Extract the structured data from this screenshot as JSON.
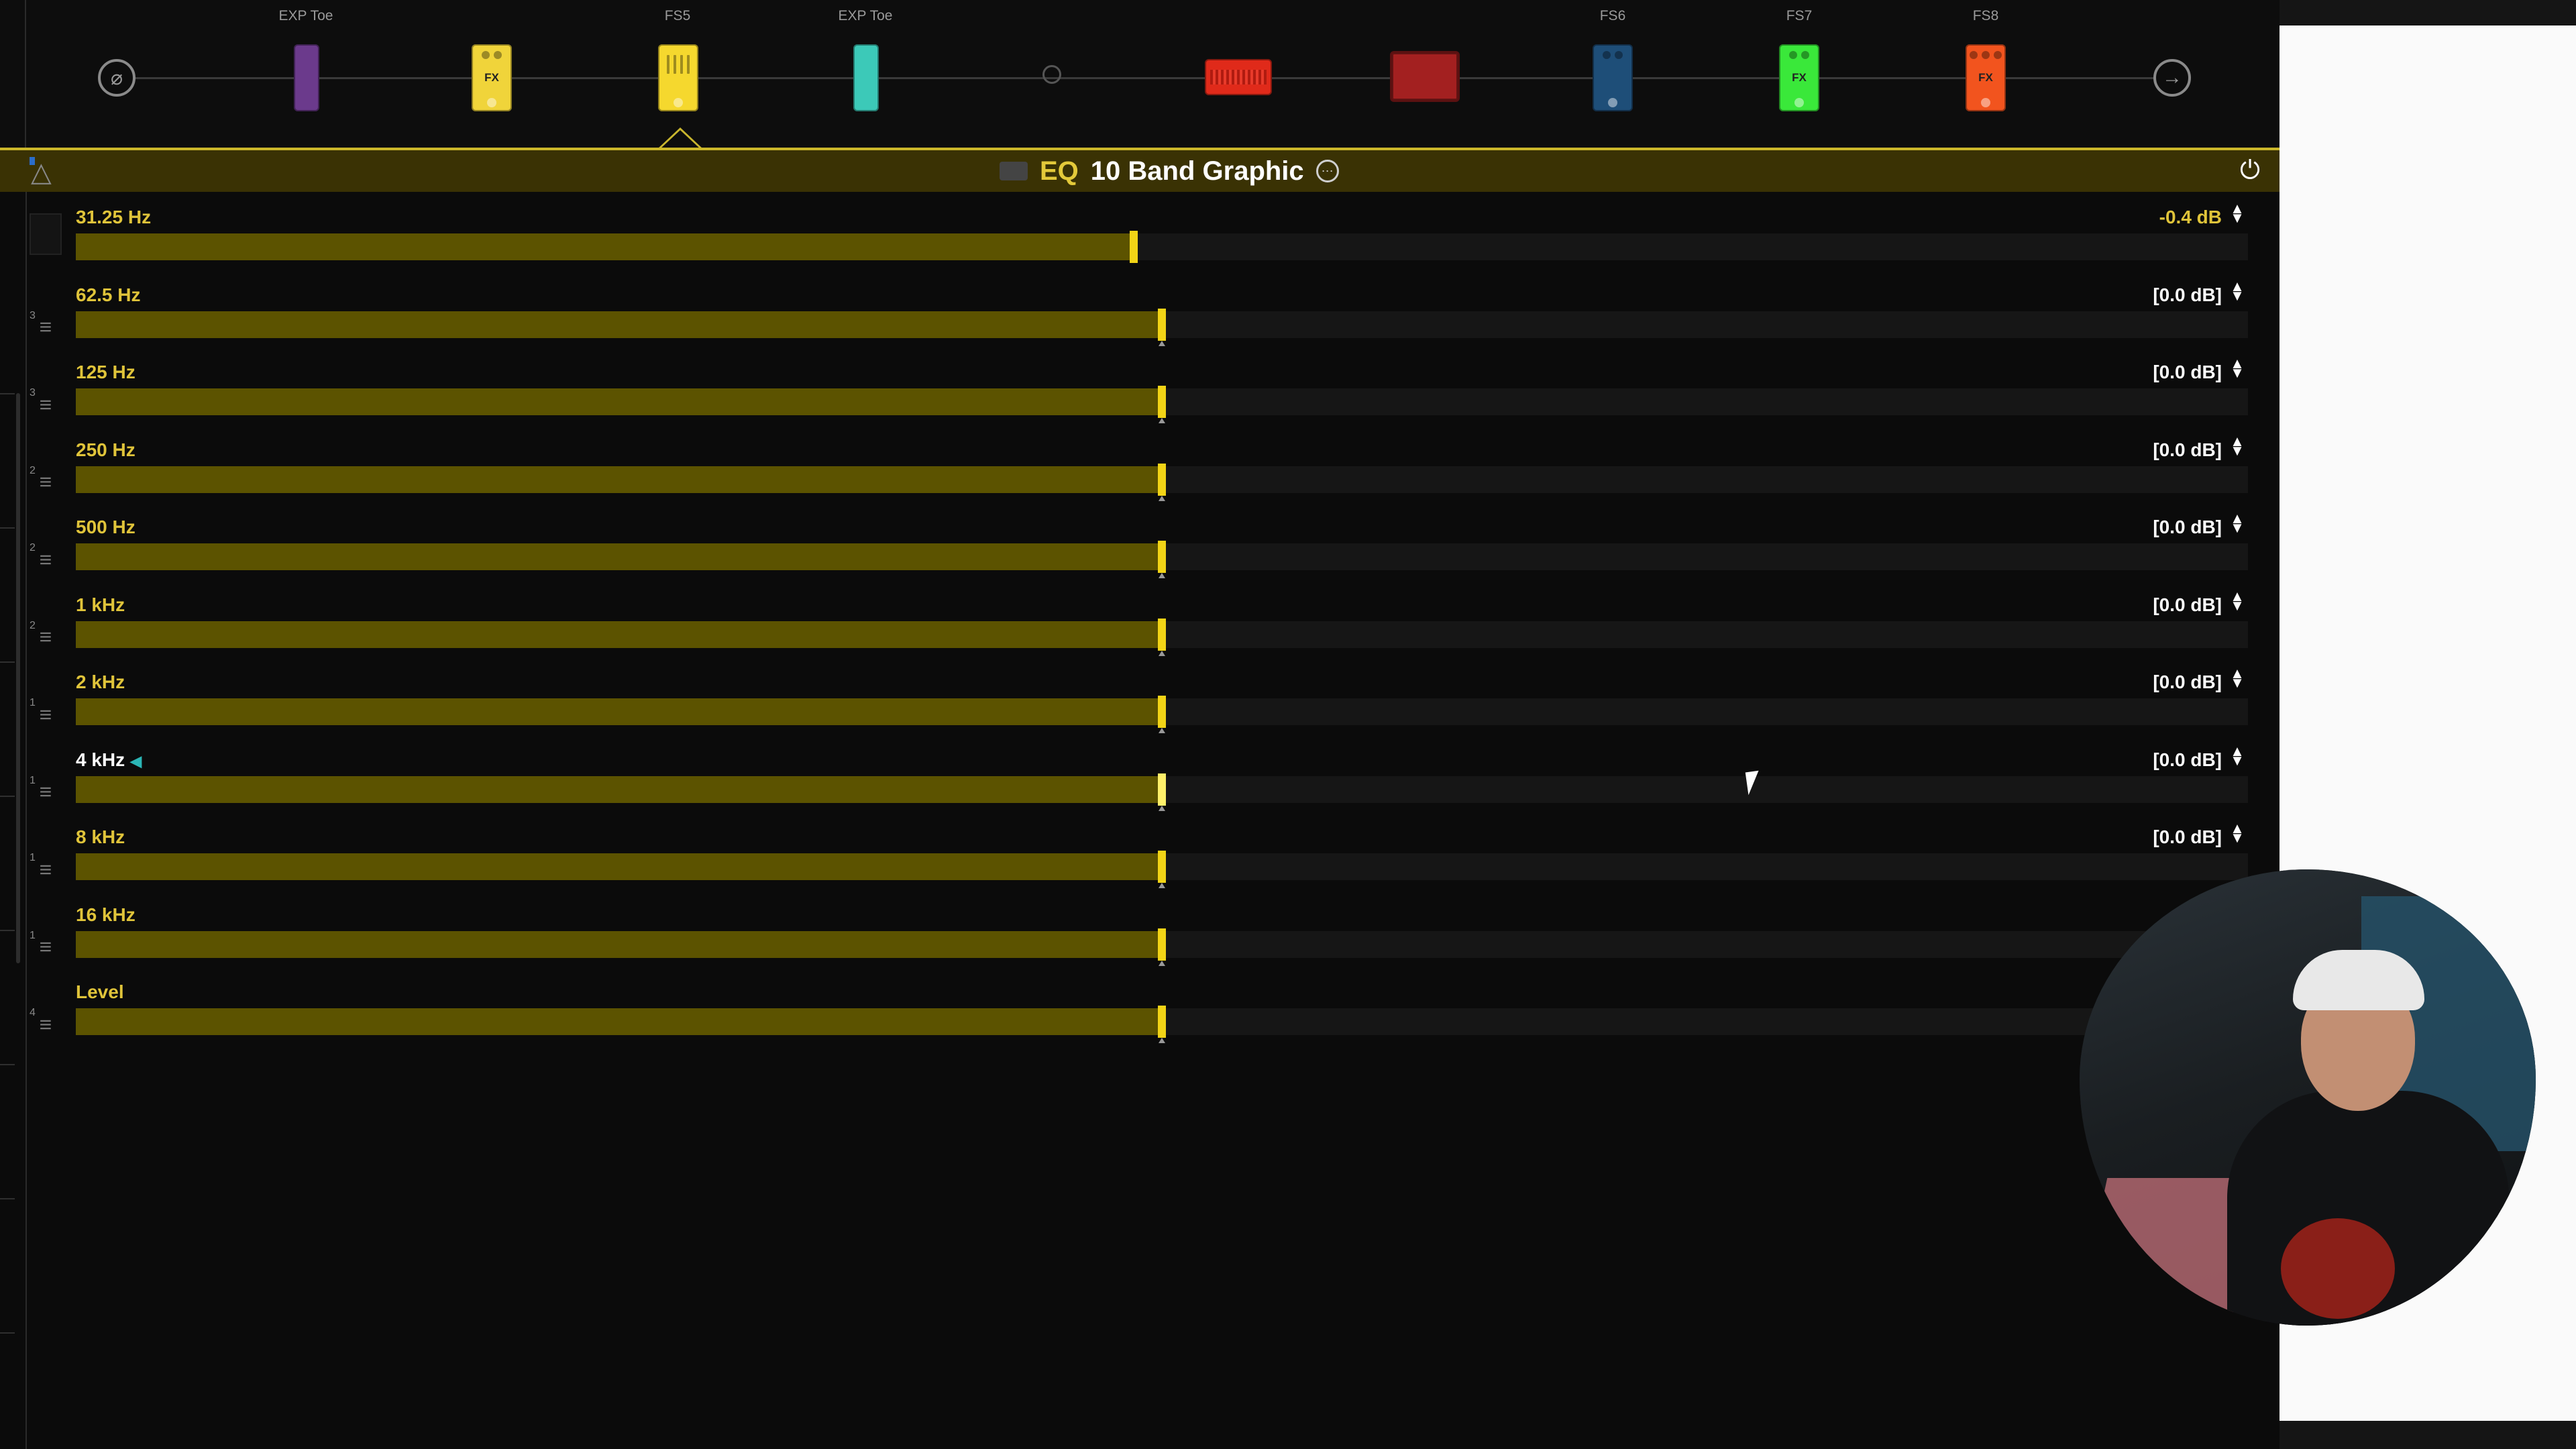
{
  "chain": {
    "fs_labels": [
      "EXP Toe",
      "FS5",
      "EXP Toe",
      "FS6",
      "FS7",
      "FS8"
    ],
    "blocks": [
      {
        "name": "input",
        "color": "#8a8a8a"
      },
      {
        "name": "wah",
        "color": "#6b3a8c"
      },
      {
        "name": "yellow-fx",
        "color": "#f0d43a",
        "fx": "FX"
      },
      {
        "name": "eq-selected",
        "color": "#f5d82e"
      },
      {
        "name": "teal-volume",
        "color": "#3cc9b8"
      },
      {
        "name": "split",
        "color": "#555555"
      },
      {
        "name": "amp",
        "color": "#e02a1a"
      },
      {
        "name": "cab",
        "color": "#a32020"
      },
      {
        "name": "blue-fx",
        "color": "#1e4e78"
      },
      {
        "name": "green-fx",
        "color": "#3ae83a",
        "fx": "FX"
      },
      {
        "name": "orange-fx",
        "color": "#f2541e",
        "fx": "FX"
      },
      {
        "name": "output",
        "color": "#8a8a8a"
      }
    ]
  },
  "header": {
    "category": "EQ",
    "model": "10 Band Graphic",
    "accent_color": "#e0c43a"
  },
  "params": [
    {
      "label": "31.25 Hz",
      "value": "-0.4 dB",
      "fill": 0.487,
      "changed": true
    },
    {
      "label": "62.5 Hz",
      "value": "[0.0 dB]",
      "fill": 0.5
    },
    {
      "label": "125 Hz",
      "value": "[0.0 dB]",
      "fill": 0.5
    },
    {
      "label": "250 Hz",
      "value": "[0.0 dB]",
      "fill": 0.5
    },
    {
      "label": "500 Hz",
      "value": "[0.0 dB]",
      "fill": 0.5
    },
    {
      "label": "1 kHz",
      "value": "[0.0 dB]",
      "fill": 0.5
    },
    {
      "label": "2 kHz",
      "value": "[0.0 dB]",
      "fill": 0.5
    },
    {
      "label": "4 kHz",
      "value": "[0.0 dB]",
      "fill": 0.5,
      "active": true
    },
    {
      "label": "8 kHz",
      "value": "[0.0 dB]",
      "fill": 0.5
    },
    {
      "label": "16 kHz",
      "value": "",
      "fill": 0.5
    },
    {
      "label": "Level",
      "value": "",
      "fill": 0.5
    }
  ],
  "assign_numbers": [
    "",
    "3",
    "3",
    "2",
    "2",
    "2",
    "1",
    "1",
    "1",
    "1",
    "4"
  ]
}
